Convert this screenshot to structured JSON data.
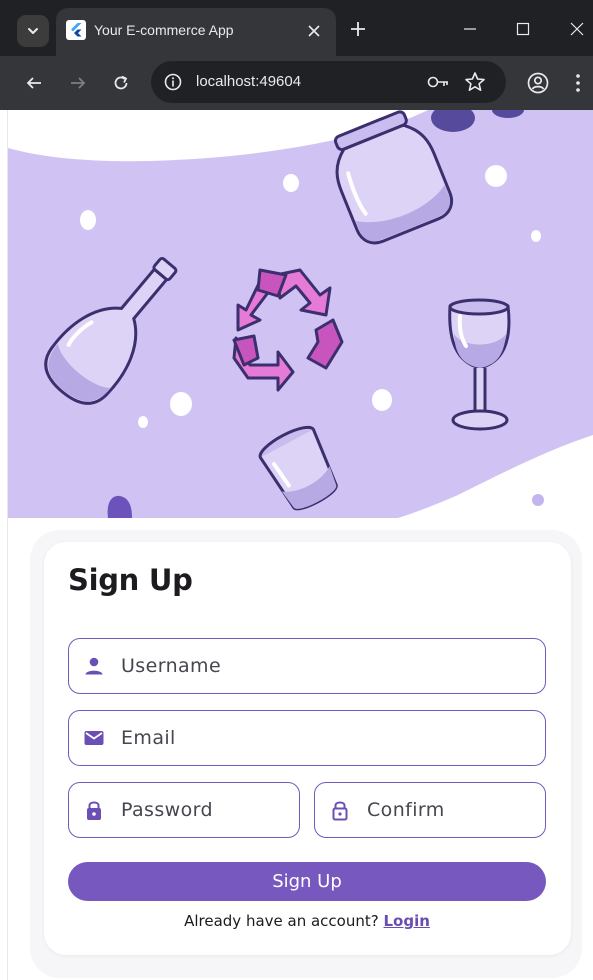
{
  "browser": {
    "tab_title": "Your E-commerce App",
    "url": "localhost:49604",
    "icons": [
      "tab-search-icon",
      "flutter-favicon-icon",
      "close-icon",
      "plus-icon",
      "minimize-icon",
      "maximize-icon",
      "close-window-icon",
      "back-arrow-icon",
      "forward-arrow-icon",
      "reload-icon",
      "info-icon",
      "key-icon",
      "star-icon",
      "profile-icon",
      "kebab-menu-icon"
    ]
  },
  "hero": {
    "background_color": "#d0c3f3",
    "illustration": [
      "bottle-icon",
      "jar-icon",
      "recycle-icon",
      "wine-glass-icon",
      "cup-icon"
    ]
  },
  "signup": {
    "title": "Sign Up",
    "username_placeholder": "Username",
    "email_placeholder": "Email",
    "password_placeholder": "Password",
    "confirm_placeholder": "Confirm",
    "button_label": "Sign Up",
    "login_prompt": "Already have an account? ",
    "login_link": "Login"
  },
  "colors": {
    "accent": "#7758bf",
    "field_border": "#7558bd",
    "hero_purple": "#d0c3f3",
    "recycle_pink": "#e57bd7"
  }
}
